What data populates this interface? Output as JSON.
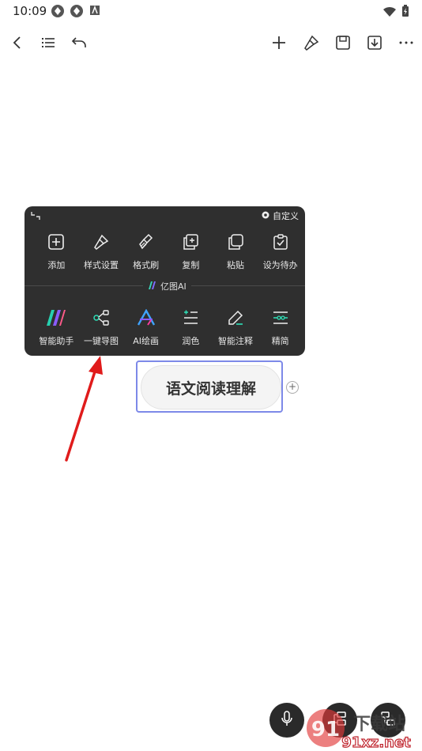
{
  "status_bar": {
    "time": "10:09"
  },
  "toolbar": {
    "back": "back-icon",
    "outline": "outline-list-icon",
    "undo": "undo-icon",
    "add": "plus-icon",
    "style": "brush-icon",
    "save": "save-icon",
    "export": "download-icon",
    "more": "more-icon"
  },
  "popup": {
    "customize_label": "自定义",
    "row1": [
      {
        "label": "添加",
        "icon": "add-box-icon"
      },
      {
        "label": "样式设置",
        "icon": "paint-brush-icon"
      },
      {
        "label": "格式刷",
        "icon": "format-brush-icon"
      },
      {
        "label": "复制",
        "icon": "copy-icon"
      },
      {
        "label": "粘贴",
        "icon": "paste-icon"
      },
      {
        "label": "设为待办",
        "icon": "todo-icon"
      }
    ],
    "ai_section_label": "亿图AI",
    "row2": [
      {
        "label": "智能助手",
        "icon": "ai-assistant-icon"
      },
      {
        "label": "一键导图",
        "icon": "mindmap-share-icon"
      },
      {
        "label": "AI绘画",
        "icon": "ai-paint-icon"
      },
      {
        "label": "润色",
        "icon": "polish-icon"
      },
      {
        "label": "智能注释",
        "icon": "annotate-icon"
      },
      {
        "label": "精简",
        "icon": "simplify-icon"
      }
    ]
  },
  "node": {
    "text": "语文阅读理解"
  },
  "colors": {
    "popup_bg": "#2f2f2f",
    "selection": "#7d89e8",
    "arrow": "#e01b1b"
  },
  "watermark": {
    "line1": "下载站",
    "line2": "91xz.net"
  }
}
